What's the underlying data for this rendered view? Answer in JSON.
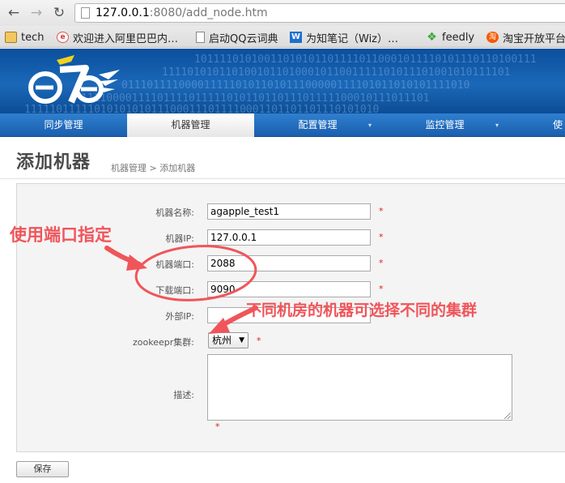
{
  "browser": {
    "url_host": "127.0.0.1",
    "url_rest": ":8080/add_node.htm",
    "icons": {
      "back": "back-arrow-icon",
      "forward": "forward-arrow-icon",
      "reload": "reload-icon"
    },
    "bookmarks": [
      {
        "label": "tech",
        "icon": "folder-icon"
      },
      {
        "label": "欢迎进入阿里巴巴内…",
        "icon": "alibaba-icon"
      },
      {
        "label": "启动QQ云词典",
        "icon": "document-icon"
      },
      {
        "label": "为知笔记（Wiz）…",
        "icon": "wiz-icon"
      },
      {
        "label": "feedly",
        "icon": "feedly-icon"
      },
      {
        "label": "淘宝开放平台",
        "icon": "taobao-icon"
      }
    ]
  },
  "banner": {
    "binary_lines": [
      "101111010100110101011011110110001011110101110110100111",
      "1111010101101001011010001011001111101011101001010111101",
      "0111011110000111110101101011100000111101011010101111010",
      "1111000011110111101111101011011011101111100010111011101",
      "11111011111010101010111000111011110001101101101110101010"
    ],
    "accent_color": "#1b68b8"
  },
  "menu": {
    "items": [
      {
        "label": "同步管理",
        "active": false
      },
      {
        "label": "机器管理",
        "active": true
      },
      {
        "label": "配置管理",
        "active": false
      },
      {
        "label": "监控管理",
        "active": false
      },
      {
        "label": "使",
        "active": false
      }
    ],
    "dropdown_marker": "▾"
  },
  "page": {
    "title": "添加机器",
    "breadcrumb": "机器管理 > 添加机器"
  },
  "form": {
    "required_marker": "*",
    "fields": [
      {
        "label": "机器名称:",
        "value": "agapple_test1"
      },
      {
        "label": "机器IP:",
        "value": "127.0.0.1"
      },
      {
        "label": "机器端口:",
        "value": "2088"
      },
      {
        "label": "下载端口:",
        "value": "9090"
      },
      {
        "label": "外部IP:",
        "value": ""
      }
    ],
    "zookeeper_label": "zookeepr集群:",
    "zookeeper_value": "杭州",
    "zookeeper_caret": "▼",
    "description_label": "描述:",
    "save_label": "保存"
  },
  "annotations": {
    "left_note": "使用端口指定",
    "right_note": "不同机房的机器可选择不同的集群",
    "color": "#f0555a"
  }
}
